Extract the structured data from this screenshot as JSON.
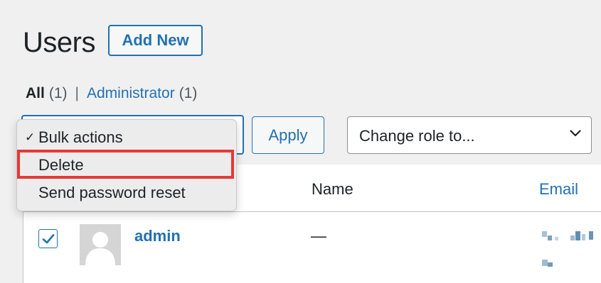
{
  "header": {
    "title": "Users",
    "add_new_label": "Add New"
  },
  "filters": {
    "all_label": "All",
    "all_count": "(1)",
    "separator": "|",
    "administrator_label": "Administrator",
    "administrator_count": "(1)"
  },
  "bulk_actions": {
    "options": [
      "Bulk actions",
      "Delete",
      "Send password reset"
    ],
    "selected_index": 0,
    "highlighted_option": "Delete",
    "apply_label": "Apply"
  },
  "change_role": {
    "label": "Change role to..."
  },
  "table": {
    "columns": [
      "Name",
      "Email"
    ],
    "rows": [
      {
        "username": "admin",
        "name": "—",
        "checked": true
      }
    ]
  },
  "colors": {
    "link": "#2271b1",
    "highlight": "#e53935",
    "background": "#f0f0f1"
  },
  "icons": {
    "selected_check": "check-icon",
    "select_arrow": "chevron-down-icon",
    "avatar": "default-avatar-icon"
  }
}
